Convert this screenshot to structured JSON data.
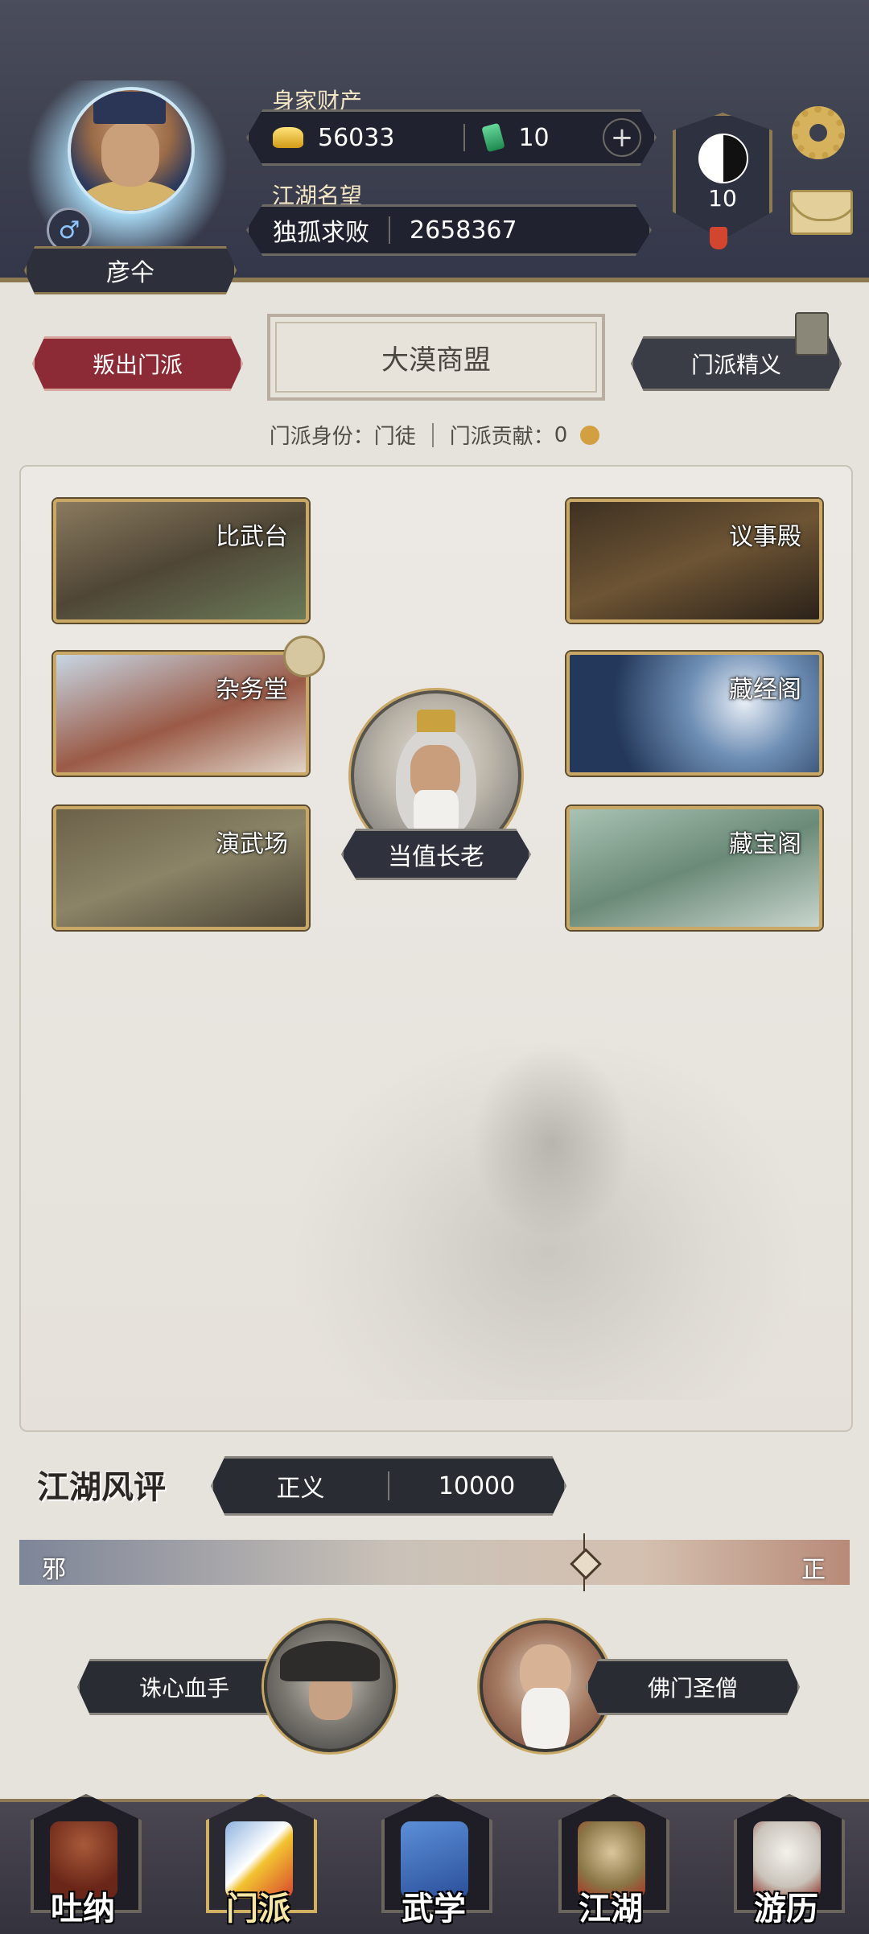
{
  "header": {
    "player_name": "彦仐",
    "gender_symbol": "♂",
    "wealth_label": "身家财产",
    "gold": "56033",
    "jade": "10",
    "add_symbol": "+",
    "fame_label": "江湖名望",
    "fame_title": "独孤求败",
    "fame_value": "2658367",
    "level": "10"
  },
  "sect": {
    "leave_button": "叛出门派",
    "name": "大漠商盟",
    "elite_button": "门派精义",
    "identity_label": "门派身份：",
    "identity_value": "门徒",
    "contribution_label": "门派贡献：",
    "contribution_value": "0",
    "buildings": [
      {
        "label": "比武台"
      },
      {
        "label": "议事殿"
      },
      {
        "label": "杂务堂"
      },
      {
        "label": "藏经阁"
      },
      {
        "label": "演武场"
      },
      {
        "label": "藏宝阁"
      }
    ],
    "elder_label": "当值长老"
  },
  "reputation": {
    "title": "江湖风评",
    "alignment": "正义",
    "value": "10000",
    "left_label": "邪",
    "right_label": "正",
    "marker_position_fraction": 0.68,
    "npc_left": "诛心血手",
    "npc_right": "佛门圣僧"
  },
  "nav": [
    {
      "label": "吐纳",
      "active": false
    },
    {
      "label": "门派",
      "active": true
    },
    {
      "label": "武学",
      "active": false
    },
    {
      "label": "江湖",
      "active": false
    },
    {
      "label": "游历",
      "active": false
    }
  ],
  "colors": {
    "accent_gold": "#c9a866",
    "danger_red": "#8c2b35",
    "topbar": "#3c3f4e"
  }
}
